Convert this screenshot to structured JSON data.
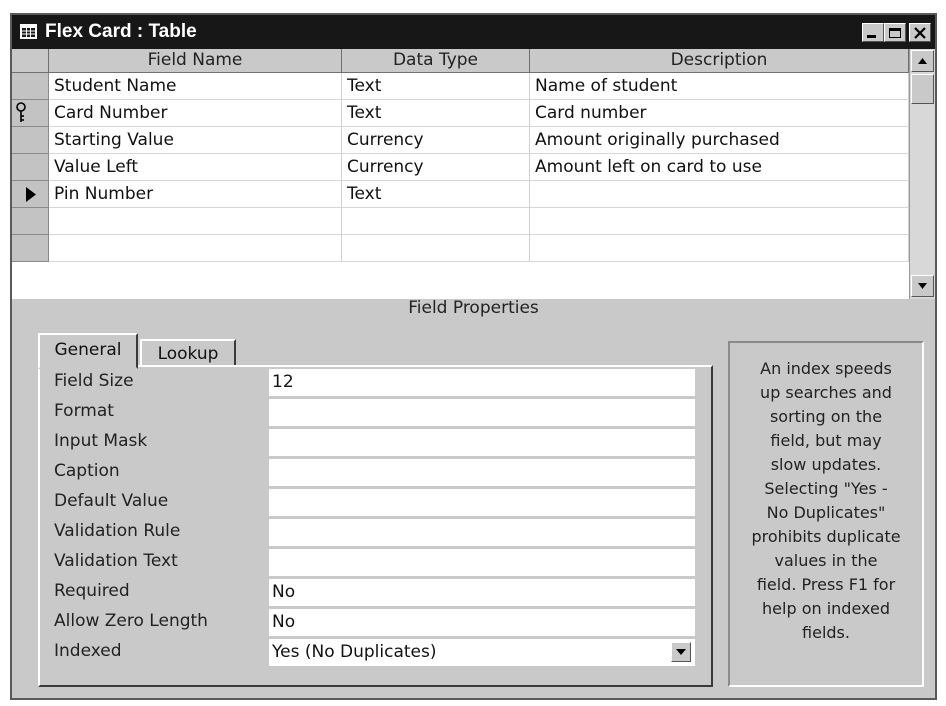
{
  "window": {
    "title": "Flex Card : Table"
  },
  "grid": {
    "headers": {
      "field_name": "Field Name",
      "data_type": "Data Type",
      "description": "Description"
    },
    "rows": [
      {
        "field": "Student Name",
        "type": "Text",
        "desc": "Name of student",
        "selector": "none"
      },
      {
        "field": "Card Number",
        "type": "Text",
        "desc": "Card number",
        "selector": "key-icon"
      },
      {
        "field": "Starting Value",
        "type": "Currency",
        "desc": "Amount originally purchased",
        "selector": "none"
      },
      {
        "field": "Value Left",
        "type": "Currency",
        "desc": "Amount left on card to use",
        "selector": "none"
      },
      {
        "field": "Pin Number",
        "type": "Text",
        "desc": "",
        "selector": "current-row-arrow-icon"
      },
      {
        "field": "",
        "type": "",
        "desc": "",
        "selector": "none"
      },
      {
        "field": "",
        "type": "",
        "desc": "",
        "selector": "none"
      }
    ]
  },
  "field_properties": {
    "label": "Field Properties",
    "tabs": [
      "General",
      "Lookup"
    ],
    "active_tab": "General",
    "properties": [
      {
        "label": "Field Size",
        "value": "12"
      },
      {
        "label": "Format",
        "value": ""
      },
      {
        "label": "Input Mask",
        "value": ""
      },
      {
        "label": "Caption",
        "value": ""
      },
      {
        "label": "Default Value",
        "value": ""
      },
      {
        "label": "Validation Rule",
        "value": ""
      },
      {
        "label": "Validation Text",
        "value": ""
      },
      {
        "label": "Required",
        "value": "No"
      },
      {
        "label": "Allow Zero Length",
        "value": "No"
      },
      {
        "label": "Indexed",
        "value": "Yes (No Duplicates)"
      }
    ],
    "help_lines": [
      "An index speeds",
      "up searches and",
      "sorting on the",
      "field, but may",
      "slow updates.",
      "Selecting \"Yes -",
      "No Duplicates\"",
      "prohibits duplicate",
      "values in the",
      "field.  Press F1 for",
      "help on indexed",
      "fields."
    ]
  },
  "colors": {
    "title_bar": "#171717",
    "chrome": "#c9c9c9",
    "cell": "#ffffff"
  }
}
